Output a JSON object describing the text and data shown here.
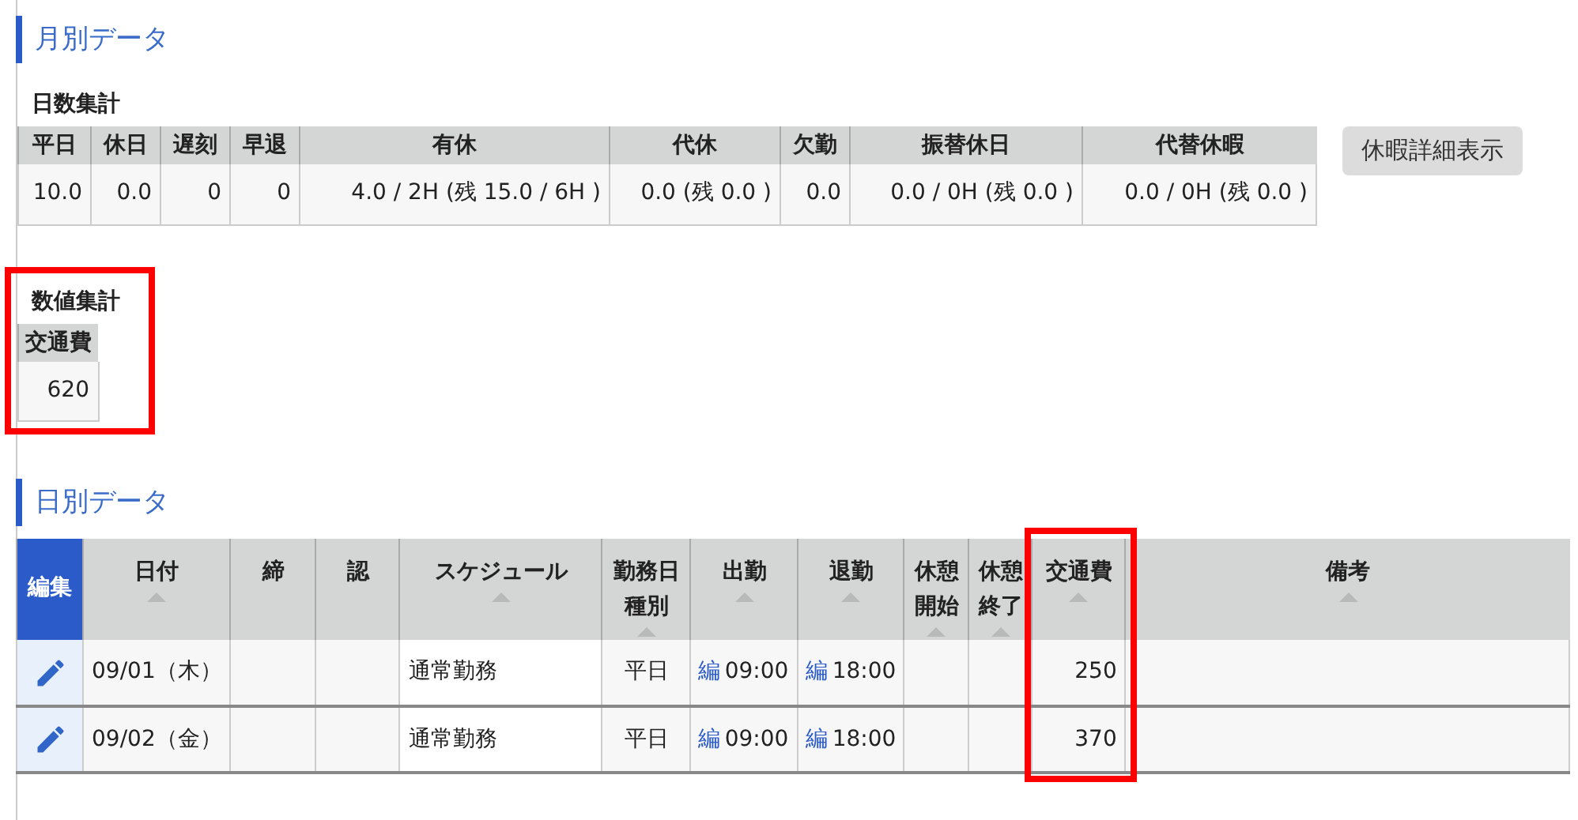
{
  "monthly_section": {
    "title": "月別データ"
  },
  "day_summary": {
    "title": "日数集計",
    "columns": [
      "平日",
      "休日",
      "遅刻",
      "早退",
      "有休",
      "代休",
      "欠勤",
      "振替休日",
      "代替休暇"
    ],
    "values": [
      "10.0",
      "0.0",
      "0",
      "0",
      "4.0 / 2H (残 15.0 / 6H )",
      "0.0 (残 0.0 )",
      "0.0",
      "0.0 / 0H (残 0.0 )",
      "0.0 / 0H (残 0.0 )"
    ]
  },
  "leave_detail_button": "休暇詳細表示",
  "numeric_summary": {
    "title": "数値集計",
    "highlighted": true,
    "columns": [
      "交通費"
    ],
    "values": [
      "620"
    ]
  },
  "daily_section": {
    "title": "日別データ"
  },
  "daily_table": {
    "columns": [
      {
        "label": "編集",
        "sortable": false,
        "highlighted": false
      },
      {
        "label": "日付",
        "sortable": true,
        "highlighted": false
      },
      {
        "label": "締",
        "sortable": false,
        "highlighted": false
      },
      {
        "label": "認",
        "sortable": false,
        "highlighted": false
      },
      {
        "label": "スケジュール",
        "sortable": true,
        "highlighted": false
      },
      {
        "label": "勤務日種別",
        "sortable": true,
        "highlighted": false
      },
      {
        "label": "出勤",
        "sortable": true,
        "highlighted": false
      },
      {
        "label": "退勤",
        "sortable": true,
        "highlighted": false
      },
      {
        "label": "休憩開始",
        "sortable": true,
        "highlighted": false
      },
      {
        "label": "休憩終了",
        "sortable": true,
        "highlighted": false
      },
      {
        "label": "交通費",
        "sortable": true,
        "highlighted": true
      },
      {
        "label": "備考",
        "sortable": true,
        "highlighted": false
      }
    ],
    "rows": [
      {
        "date": "09/01（木）",
        "schedule": "通常勤務",
        "day_type": "平日",
        "clock_in": {
          "link": "編",
          "time": "09:00"
        },
        "clock_out": {
          "link": "編",
          "time": "18:00"
        },
        "transport": "250"
      },
      {
        "date": "09/02（金）",
        "schedule": "通常勤務",
        "day_type": "平日",
        "clock_in": {
          "link": "編",
          "time": "09:00"
        },
        "clock_out": {
          "link": "編",
          "time": "18:00"
        },
        "transport": "370"
      }
    ]
  }
}
